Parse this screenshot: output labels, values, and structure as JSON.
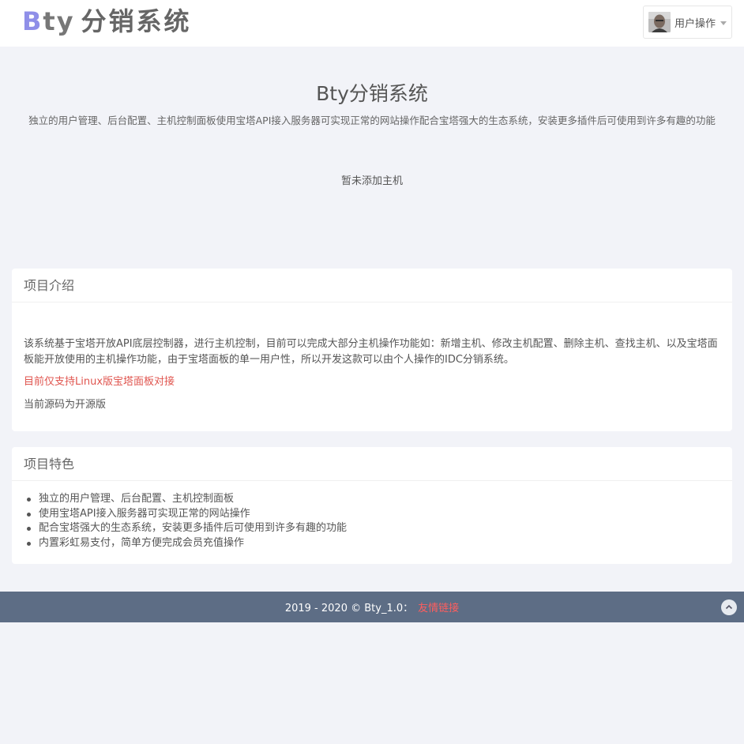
{
  "header": {
    "logo_b": "B",
    "logo_ty": "ty",
    "logo_cn": "分销系统",
    "user_menu_label": "用户操作"
  },
  "hero": {
    "title": "Bty分销系统",
    "subtitle": "独立的用户管理、后台配置、主机控制面板使用宝塔API接入服务器可实现正常的网站操作配合宝塔强大的生态系统，安装更多插件后可使用到许多有趣的功能",
    "empty_message": "暂未添加主机"
  },
  "intro": {
    "title": "项目介绍",
    "paragraph1": "该系统基于宝塔开放API底层控制器，进行主机控制，目前可以完成大部分主机操作功能如：新增主机、修改主机配置、删除主机、查找主机、以及宝塔面板能开放使用的主机操作功能，由于宝塔面板的单一用户性，所以开发这款可以由个人操作的IDC分销系统。",
    "notice": "目前仅支持Linux版宝塔面板对接",
    "paragraph3": "当前源码为开源版"
  },
  "features": {
    "title": "项目特色",
    "items": [
      "独立的用户管理、后台配置、主机控制面板",
      "使用宝塔API接入服务器可实现正常的网站操作",
      "配合宝塔强大的生态系统，安装更多插件后可使用到许多有趣的功能",
      "内置彩虹易支付，简单方便完成会员充值操作"
    ]
  },
  "footer": {
    "copyright": "2019 - 2020 © Bty_1.0：",
    "link_label": "友情链接"
  },
  "icons": {
    "user_avatar": "avatar-icon",
    "dropdown": "chevron-down-icon",
    "back_to_top": "chevron-up-icon"
  },
  "colors": {
    "logo_accent": "#8f8fe8",
    "notice_red": "#e0554f",
    "footer_bg": "#5d6d85",
    "footer_link": "#ff5e5e",
    "page_bg": "#f2f3f8"
  }
}
